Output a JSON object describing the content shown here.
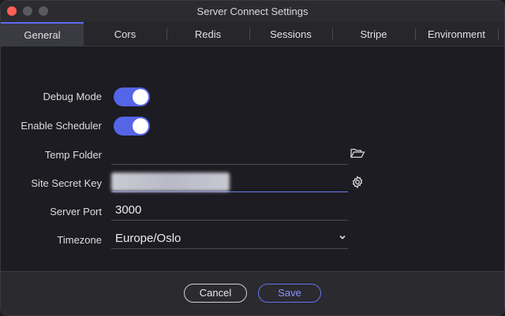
{
  "window": {
    "title": "Server Connect Settings"
  },
  "tabs": [
    {
      "label": "General",
      "active": true
    },
    {
      "label": "Cors"
    },
    {
      "label": "Redis"
    },
    {
      "label": "Sessions"
    },
    {
      "label": "Stripe"
    },
    {
      "label": "Environment"
    }
  ],
  "form": {
    "debug_mode": {
      "label": "Debug Mode",
      "on": true
    },
    "enable_scheduler": {
      "label": "Enable Scheduler",
      "on": true
    },
    "temp_folder": {
      "label": "Temp Folder",
      "value": "",
      "icon": "folder-open-icon"
    },
    "site_secret_key": {
      "label": "Site Secret Key",
      "icon": "gear-icon"
    },
    "server_port": {
      "label": "Server Port",
      "value": "3000"
    },
    "timezone": {
      "label": "Timezone",
      "value": "Europe/Oslo"
    }
  },
  "footer": {
    "cancel_label": "Cancel",
    "save_label": "Save"
  },
  "colors": {
    "accent": "#5565e8",
    "save_text": "#8a94ff"
  }
}
